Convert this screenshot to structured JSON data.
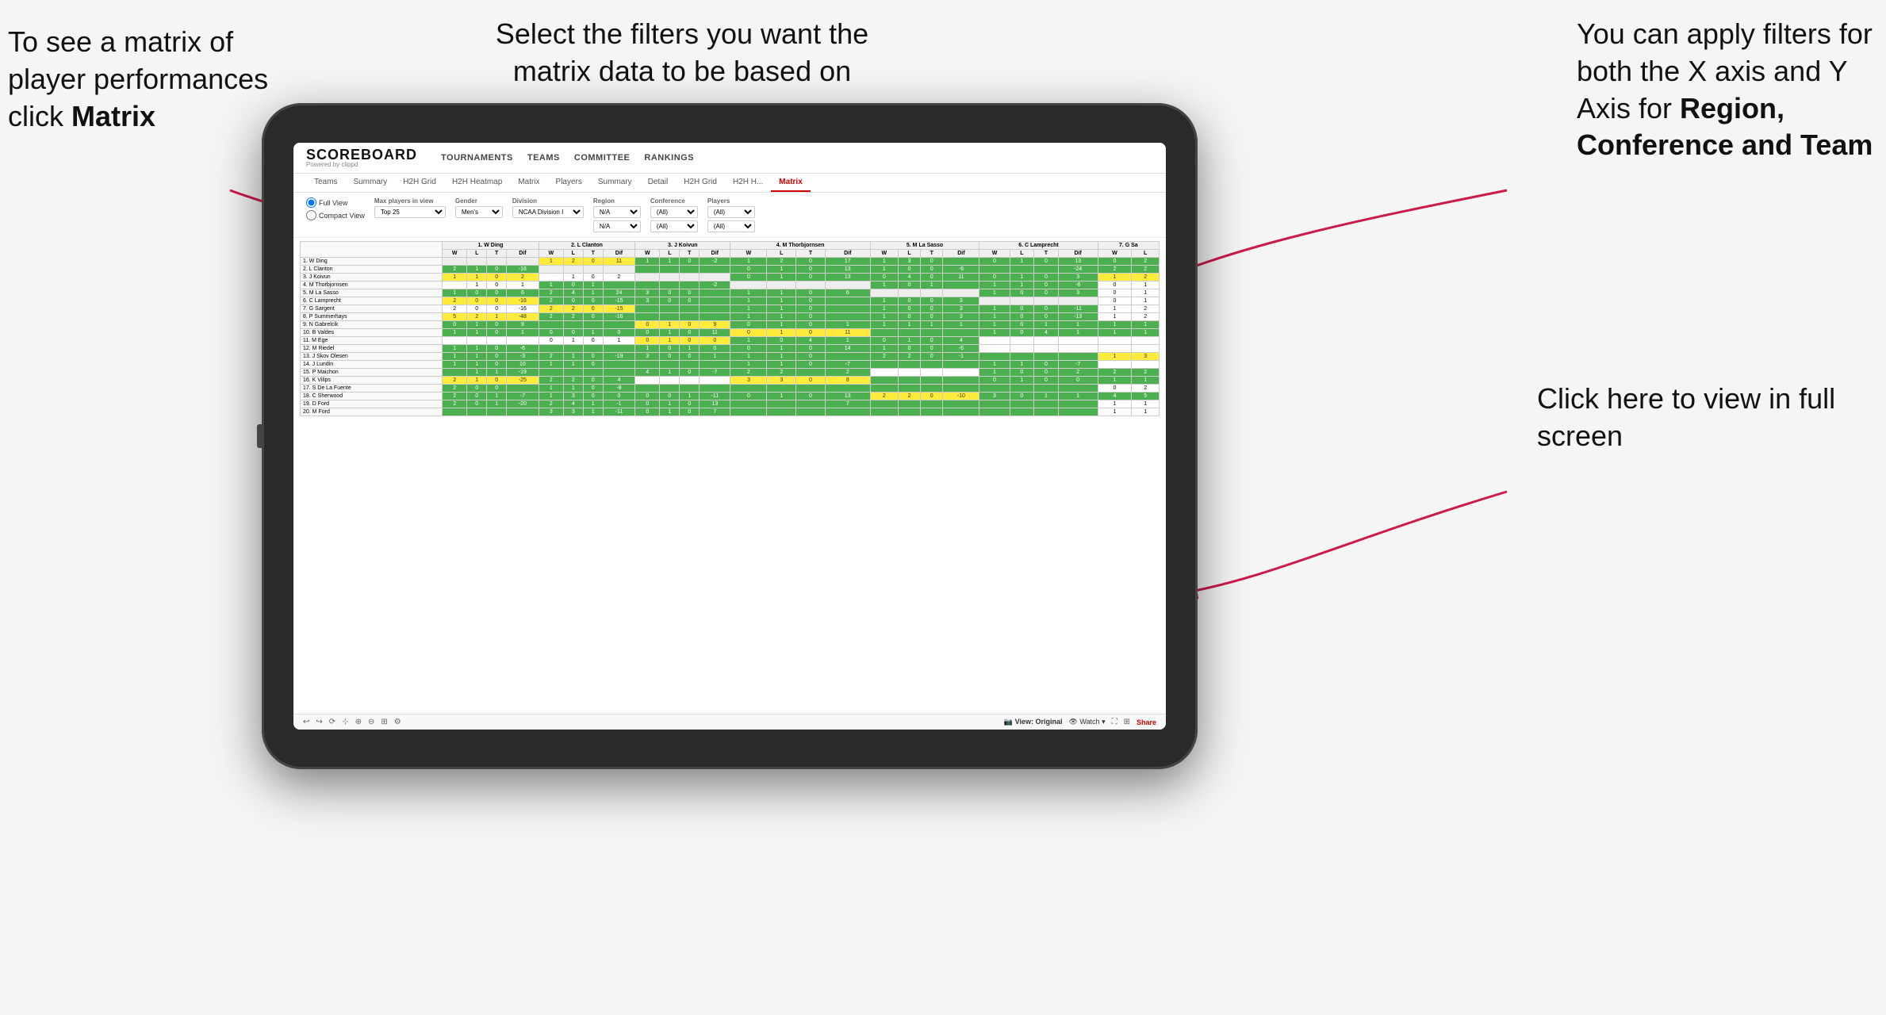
{
  "annotations": {
    "left_title": "To see a matrix of player performances click ",
    "left_bold": "Matrix",
    "center_text": "Select the filters you want the matrix data to be based on",
    "right_title_pre": "You  can apply filters for both the X axis and Y Axis for ",
    "right_bold": "Region, Conference and Team",
    "bottom_right": "Click here to view in full screen"
  },
  "header": {
    "logo": "SCOREBOARD",
    "logo_sub": "Powered by clippd",
    "nav_items": [
      "TOURNAMENTS",
      "TEAMS",
      "COMMITTEE",
      "RANKINGS"
    ]
  },
  "tabs_top": [
    "Teams",
    "Summary",
    "H2H Grid",
    "H2H Heatmap",
    "Matrix",
    "Players",
    "Summary",
    "Detail",
    "H2H Grid",
    "H2H H...",
    "Matrix"
  ],
  "active_tab": "Matrix",
  "filters": {
    "view_options": [
      "Full View",
      "Compact View"
    ],
    "max_players_label": "Max players in view",
    "max_players_value": "Top 25",
    "gender_label": "Gender",
    "gender_value": "Men's",
    "division_label": "Division",
    "division_value": "NCAA Division I",
    "region_label": "Region",
    "region_value": "N/A",
    "conference_label": "Conference",
    "conference_value": "(All)",
    "players_label": "Players",
    "players_value": "(All)"
  },
  "col_headers": [
    "1. W Ding",
    "2. L Clanton",
    "3. J Koivun",
    "4. M Thorbjornsen",
    "5. M La Sasso",
    "6. C Lamprecht",
    "7. G Sa"
  ],
  "sub_headers": [
    "W",
    "L",
    "T",
    "Dif"
  ],
  "row_players": [
    "1. W Ding",
    "2. L Clanton",
    "3. J Koivun",
    "4. M Thorbjornsen",
    "5. M La Sasso",
    "6. C Lamprecht",
    "7. G Sargent",
    "8. P Summerhays",
    "9. N Gabrelcik",
    "10. B Valdes",
    "11. M Ege",
    "12. M Riedel",
    "13. J Skov Olesen",
    "14. J Lundin",
    "15. P Maichon",
    "16. K Vilips",
    "17. S De La Fuente",
    "18. C Sherwood",
    "19. D Ford",
    "20. M Ford"
  ],
  "toolbar": {
    "view_label": "View: Original",
    "watch_label": "Watch",
    "share_label": "Share"
  },
  "colors": {
    "accent": "#cc0000",
    "arrow": "#cc1a4a"
  }
}
